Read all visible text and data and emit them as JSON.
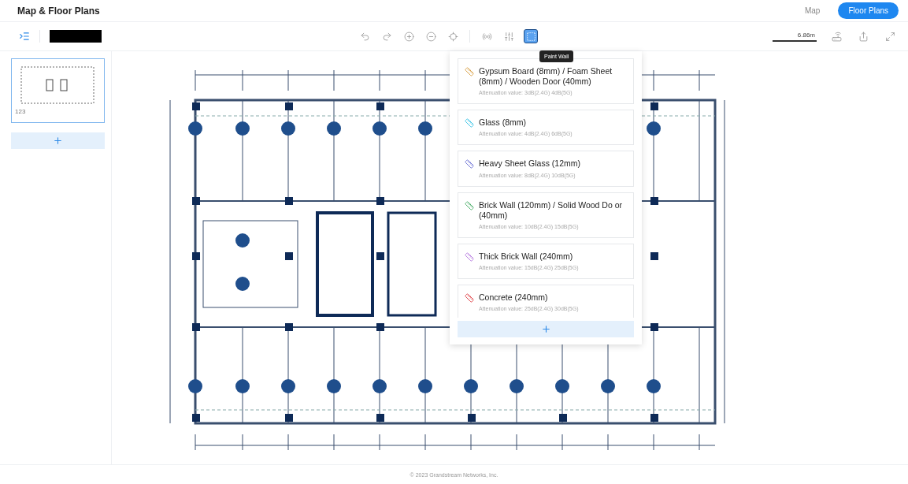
{
  "header": {
    "title": "Map & Floor Plans",
    "view_tabs": [
      {
        "label": "Map",
        "selected": false
      },
      {
        "label": "Floor Plans",
        "selected": true
      }
    ]
  },
  "toolbar": {
    "center_tools": [
      {
        "kind": "undo",
        "selected": false
      },
      {
        "kind": "redo",
        "selected": false
      },
      {
        "kind": "zoom-in",
        "selected": false
      },
      {
        "kind": "zoom-out",
        "selected": false
      },
      {
        "kind": "locate",
        "selected": false
      },
      {
        "kind": "signal",
        "selected": false
      },
      {
        "kind": "sliders",
        "selected": false
      },
      {
        "kind": "paint-wall",
        "selected": true
      }
    ],
    "tooltip": "Paint Wall",
    "scale": "6.86m",
    "right_tools": [
      {
        "kind": "device"
      },
      {
        "kind": "export"
      },
      {
        "kind": "fullscreen"
      }
    ]
  },
  "floors": [
    {
      "label": "123",
      "selected": true
    }
  ],
  "wall_materials": [
    {
      "name": "Gypsum Board (8mm) / Foam Sheet (8mm) / Wooden Door (40mm)",
      "attenuation": "Attenuation value: 3dB(2.4G) 4dB(5G)",
      "color": "#d9a046"
    },
    {
      "name": "Glass (8mm)",
      "attenuation": "Attenuation value: 4dB(2.4G) 6dB(5G)",
      "color": "#3cc4e6"
    },
    {
      "name": "Heavy Sheet Glass (12mm)",
      "attenuation": "Attenuation value: 8dB(2.4G) 10dB(5G)",
      "color": "#6f74d6"
    },
    {
      "name": "Brick Wall (120mm) / Solid Wood Do or (40mm)",
      "attenuation": "Attenuation value: 10dB(2.4G) 15dB(5G)",
      "color": "#4caf6a"
    },
    {
      "name": "Thick Brick Wall (240mm)",
      "attenuation": "Attenuation value: 15dB(2.4G) 25dB(5G)",
      "color": "#b77ce0"
    },
    {
      "name": "Concrete (240mm)",
      "attenuation": "Attenuation value: 25dB(2.4G) 30dB(5G)",
      "color": "#e0454a"
    }
  ],
  "footer": "© 2023 Grandstream Networks, Inc."
}
